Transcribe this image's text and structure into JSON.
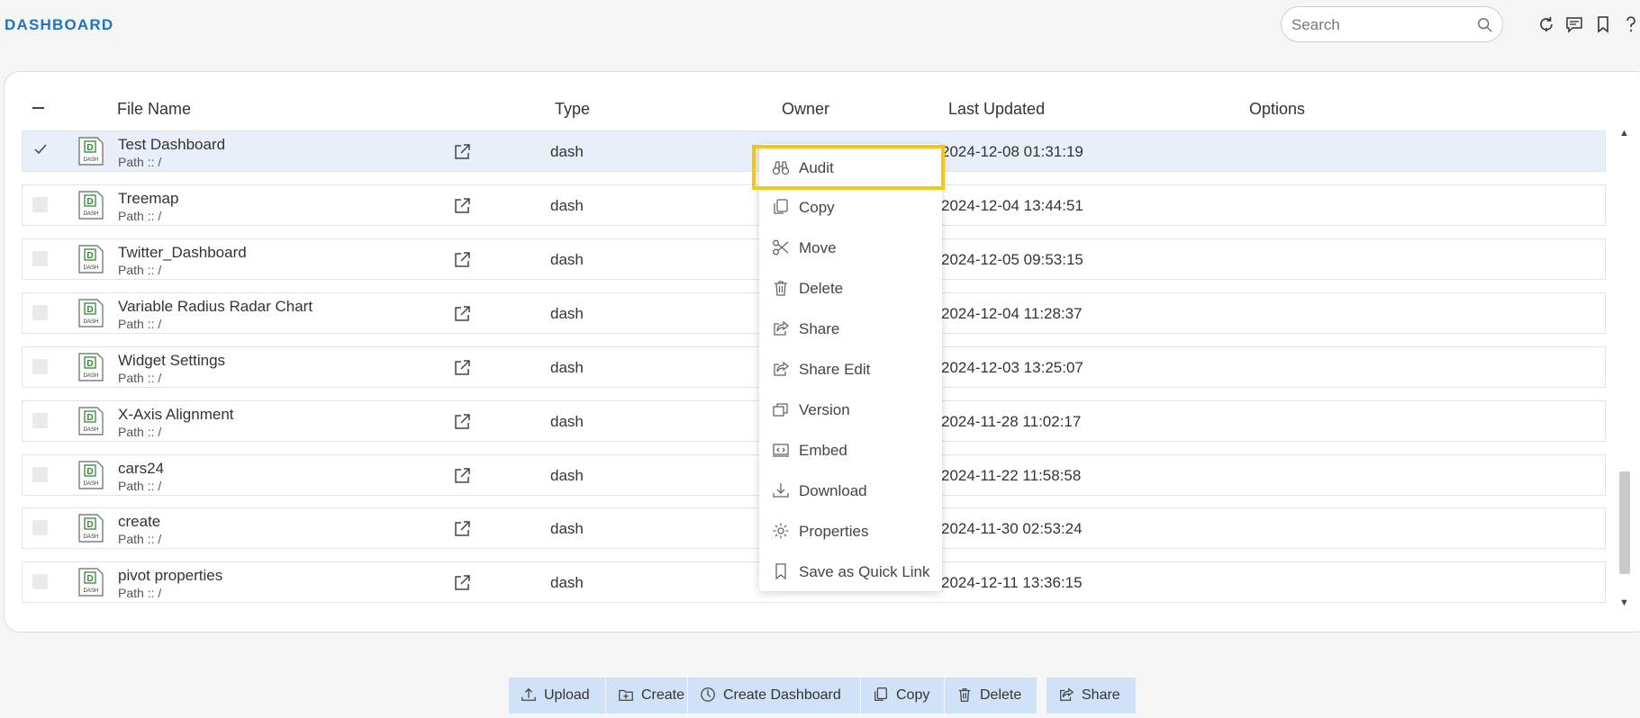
{
  "header": {
    "title": "DASHBOARD",
    "search_placeholder": "Search",
    "icons": [
      "refresh-icon",
      "comment-icon",
      "bookmark-icon",
      "help-icon"
    ]
  },
  "table": {
    "columns": [
      "File Name",
      "Type",
      "Owner",
      "Last Updated",
      "Options"
    ],
    "rows": [
      {
        "name": "Test Dashboard",
        "path": "Path :: /",
        "type": "dash",
        "updated": "2024-12-08 01:31:19",
        "selected": true
      },
      {
        "name": "Treemap",
        "path": "Path :: /",
        "type": "dash",
        "updated": "2024-12-04 13:44:51",
        "selected": false
      },
      {
        "name": "Twitter_Dashboard",
        "path": "Path :: /",
        "type": "dash",
        "updated": "2024-12-05 09:53:15",
        "selected": false
      },
      {
        "name": "Variable Radius Radar Chart",
        "path": "Path :: /",
        "type": "dash",
        "updated": "2024-12-04 11:28:37",
        "selected": false
      },
      {
        "name": "Widget Settings",
        "path": "Path :: /",
        "type": "dash",
        "updated": "2024-12-03 13:25:07",
        "selected": false
      },
      {
        "name": "X-Axis Alignment",
        "path": "Path :: /",
        "type": "dash",
        "updated": "2024-11-28 11:02:17",
        "selected": false
      },
      {
        "name": "cars24",
        "path": "Path :: /",
        "type": "dash",
        "updated": "2024-11-22 11:58:58",
        "selected": false
      },
      {
        "name": "create",
        "path": "Path :: /",
        "type": "dash",
        "updated": "2024-11-30 02:53:24",
        "selected": false
      },
      {
        "name": "pivot properties",
        "path": "Path :: /",
        "type": "dash",
        "updated": "2024-12-11 13:36:15",
        "selected": false
      }
    ]
  },
  "context_menu": {
    "items": [
      {
        "label": "Audit",
        "icon": "binoculars-icon",
        "highlighted": true
      },
      {
        "label": "Copy",
        "icon": "copy-icon"
      },
      {
        "label": "Move",
        "icon": "scissors-icon"
      },
      {
        "label": "Delete",
        "icon": "trash-icon"
      },
      {
        "label": "Share",
        "icon": "share-icon"
      },
      {
        "label": "Share Edit",
        "icon": "share-edit-icon"
      },
      {
        "label": "Version",
        "icon": "version-icon"
      },
      {
        "label": "Embed",
        "icon": "embed-icon"
      },
      {
        "label": "Download",
        "icon": "download-icon"
      },
      {
        "label": "Properties",
        "icon": "gear-icon"
      },
      {
        "label": "Save as Quick Link",
        "icon": "bookmark-icon"
      }
    ],
    "highlight_color": "#f5c518"
  },
  "bottom_actions": [
    {
      "label": "Upload",
      "icon": "upload-icon"
    },
    {
      "label": "Create",
      "icon": "create-icon"
    },
    {
      "label": "Create Dashboard",
      "icon": "dashboard-icon"
    },
    {
      "label": "Copy",
      "icon": "copy-icon"
    },
    {
      "label": "Delete",
      "icon": "trash-icon"
    },
    {
      "label": "Share",
      "icon": "share-icon"
    }
  ],
  "colors": {
    "brand": "#1b74c5",
    "selected_row": "#e8eff9",
    "action_button": "#cfe2f7"
  }
}
